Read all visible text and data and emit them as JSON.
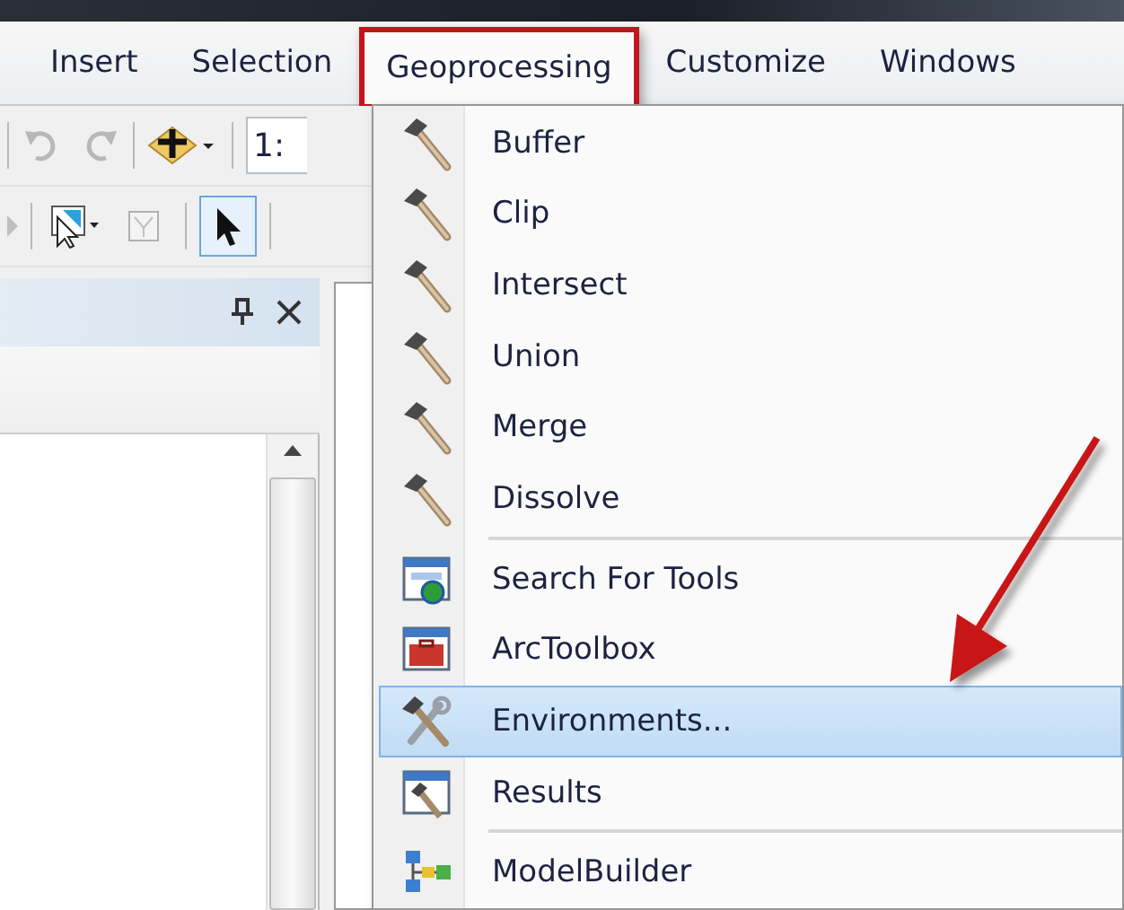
{
  "menu_bar": [
    {
      "label": "Insert",
      "selected": false
    },
    {
      "label": "Selection",
      "selected": false
    },
    {
      "label": "Geoprocessing",
      "selected": true
    },
    {
      "label": "Customize",
      "selected": false
    },
    {
      "label": "Windows",
      "selected": false
    }
  ],
  "toolbar": {
    "scale_field": "1:"
  },
  "tools": [
    {
      "kind": "select",
      "selected": false
    },
    {
      "kind": "clear",
      "selected": false
    },
    {
      "kind": "pointer",
      "selected": true
    }
  ],
  "dropdown": {
    "groups": [
      [
        {
          "label": "Buffer",
          "kind": "tool",
          "selected": false
        },
        {
          "label": "Clip",
          "kind": "tool",
          "selected": false
        },
        {
          "label": "Intersect",
          "kind": "tool",
          "selected": false
        },
        {
          "label": "Union",
          "kind": "tool",
          "selected": false
        },
        {
          "label": "Merge",
          "kind": "tool",
          "selected": false
        },
        {
          "label": "Dissolve",
          "kind": "tool",
          "selected": false
        }
      ],
      [
        {
          "label": "Search For Tools",
          "kind": "search",
          "selected": false
        },
        {
          "label": "ArcToolbox",
          "kind": "toolbox",
          "selected": false
        },
        {
          "label": "Environments...",
          "kind": "settings",
          "selected": true
        },
        {
          "label": "Results",
          "kind": "results",
          "selected": false
        }
      ],
      [
        {
          "label": "ModelBuilder",
          "kind": "model",
          "selected": false
        }
      ]
    ]
  }
}
